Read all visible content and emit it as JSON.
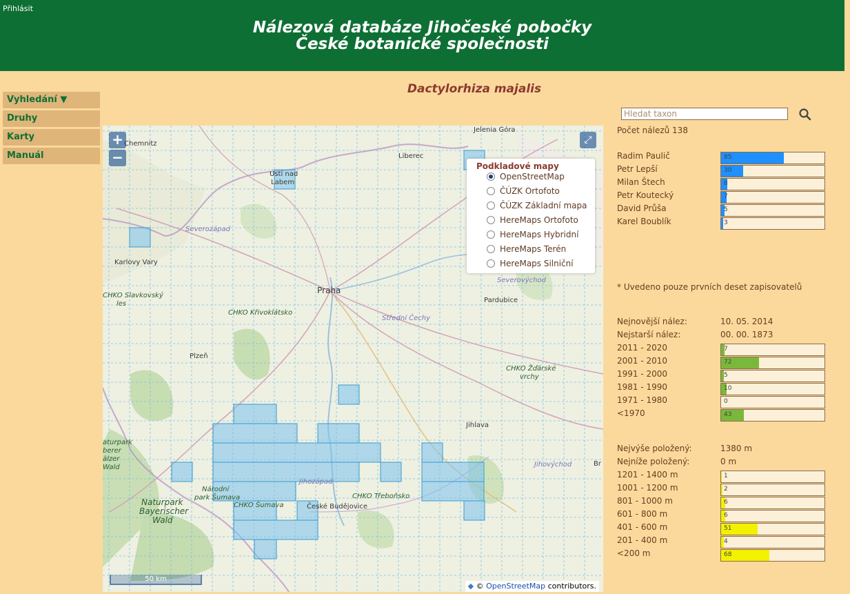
{
  "header": {
    "login_label": "Přihlásit",
    "title_line1": "Nálezová databáze Jihočeské pobočky",
    "title_line2": "České botanické společnosti"
  },
  "menu": [
    {
      "label": "Vyhledání ▼"
    },
    {
      "label": "Druhy"
    },
    {
      "label": "Karty"
    },
    {
      "label": "Manuál"
    }
  ],
  "taxon_title": "Dactylorhiza majalis",
  "map": {
    "zoom_in": "+",
    "zoom_out": "−",
    "fullscreen_icon": "expand-icon",
    "layers_title": "Podkladové mapy",
    "layers": [
      {
        "label": "OpenStreetMap",
        "selected": true
      },
      {
        "label": "ČÚZK Ortofoto",
        "selected": false
      },
      {
        "label": "ČÚZK Základní mapa",
        "selected": false
      },
      {
        "label": "HereMaps Ortofoto",
        "selected": false
      },
      {
        "label": "HereMaps Hybridní",
        "selected": false
      },
      {
        "label": "HereMaps Terén",
        "selected": false
      },
      {
        "label": "HereMaps Silniční",
        "selected": false
      }
    ],
    "scale": "50 km",
    "attribution_prefix": "©",
    "attribution_link": "OpenStreetMap",
    "attribution_suffix": "contributors.",
    "labels": {
      "chemnitz": "Chemnitz",
      "liberec": "Liberec",
      "jelenia_gora": "Jelenia Góra",
      "usti": "Ústí nad",
      "usti2": "Labem",
      "severozapad": "Severozápad",
      "karlovy_vary": "Karlovy Vary",
      "chko_slavkovsky": "CHKO Slavkovský",
      "les": "les",
      "chko_krivoklatsko": "CHKO Křivoklátsko",
      "praha": "Praha",
      "pardubice": "Pardubice",
      "severovychod": "Severovýchod",
      "stredni_cechy": "Střední Čechy",
      "plzen": "Plzeň",
      "chko_zdarske": "CHKO Žďárské",
      "vrchy": "vrchy",
      "jihlava": "Jihlava",
      "jihovychod": "Jihovýchod",
      "jihozapad": "Jihozápad",
      "naturpark_left": "aturpark",
      "oberer": "berer",
      "pfalzer": "älzer",
      "wald_left": "Wald",
      "narodni_park": "Národní",
      "park_sumava": "park Šumava",
      "chko_sumava": "CHKO Šumava",
      "ceske_budejovice": "České Budějovice",
      "chko_trebonsko": "CHKO Třeboňsko",
      "naturpark": "Naturpark",
      "bayerischer": "Bayerischer",
      "wald": "Wald",
      "br": "Br"
    }
  },
  "search": {
    "placeholder": "Hledat taxon",
    "icon": "search-icon"
  },
  "stats": {
    "count_label": "Počet nálezů 138",
    "recorders_max": 85,
    "recorders": [
      {
        "name": "Radim Paulič",
        "count": 85
      },
      {
        "name": "Petr Lepší",
        "count": 30
      },
      {
        "name": "Milan Štech",
        "count": 8
      },
      {
        "name": "Petr Koutecký",
        "count": 7
      },
      {
        "name": "David Průša",
        "count": 5
      },
      {
        "name": "Karel Boublík",
        "count": 3
      }
    ],
    "recorders_note": "* Uvedeno pouze prvních deset zapisovatelů",
    "newest_label": "Nejnovější nález:",
    "newest_value": "10. 05. 2014",
    "oldest_label": "Nejstarší nález:",
    "oldest_value": "00. 00. 1873",
    "decades_max": 100,
    "decades": [
      {
        "label": "2011 - 2020",
        "count": 7
      },
      {
        "label": "2001 - 2010",
        "count": 72
      },
      {
        "label": "1991 - 2000",
        "count": 5
      },
      {
        "label": "1981 - 1990",
        "count": 10
      },
      {
        "label": "1971 - 1980",
        "count": 0
      },
      {
        "label": "<1970",
        "count": 43
      }
    ],
    "highest_label": "Nejvýše položený:",
    "highest_value": "1380 m",
    "lowest_label": "Nejníže položený:",
    "lowest_value": "0 m",
    "altitudes_max": 100,
    "altitudes": [
      {
        "label": "1201 - 1400 m",
        "count": 1
      },
      {
        "label": "1001 - 1200 m",
        "count": 2
      },
      {
        "label": "801 - 1000 m",
        "count": 6
      },
      {
        "label": "601 - 800 m",
        "count": 6
      },
      {
        "label": "401 - 600 m",
        "count": 51
      },
      {
        "label": "201 - 400 m",
        "count": 4
      },
      {
        "label": "<200 m",
        "count": 68
      }
    ]
  },
  "colors": {
    "header_bg": "#0e6f34",
    "recorder_bar": "#1e90ff",
    "decade_bar": "#7ab83c",
    "altitude_bar": "#f2f200",
    "grid_square": "#7bc3ee"
  }
}
